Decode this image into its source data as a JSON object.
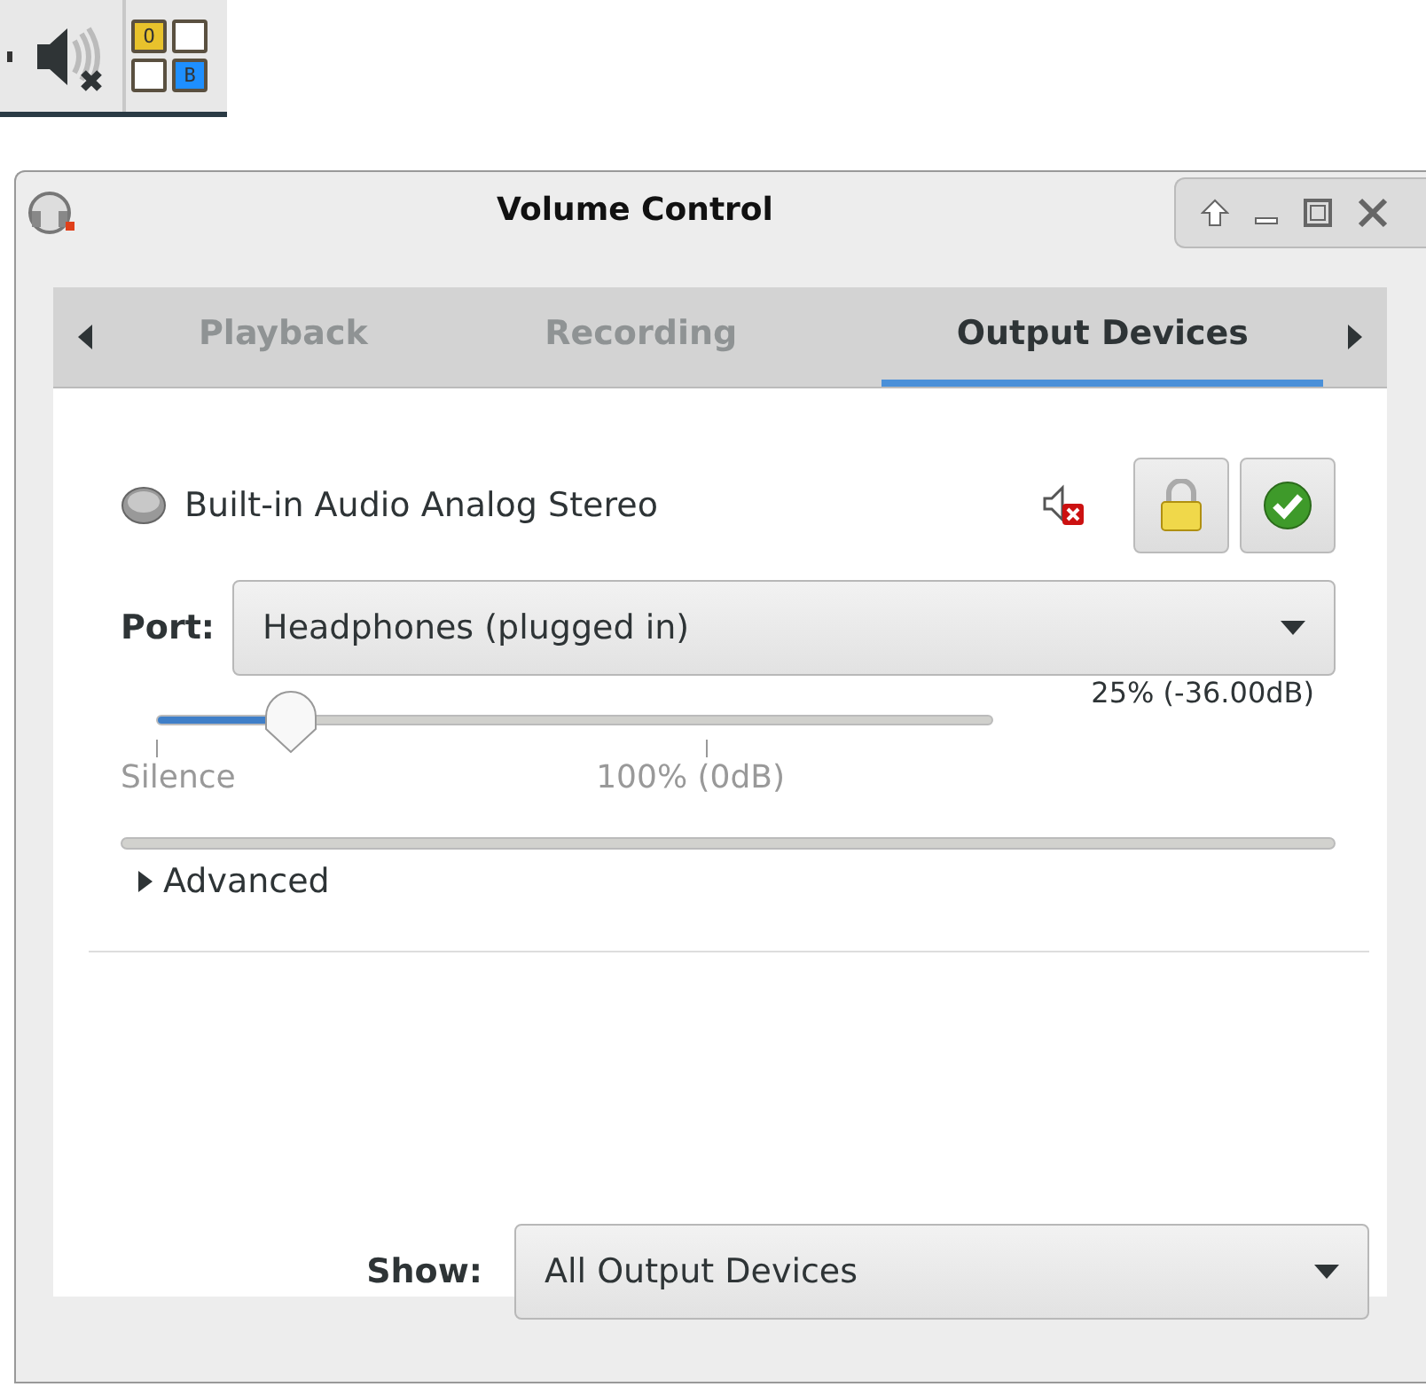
{
  "tray": {
    "pager": [
      {
        "label": "O",
        "color": "#e8c22c"
      },
      {
        "color": "#ffffff"
      },
      {
        "color": "#ffffff"
      },
      {
        "label": "B",
        "color": "#1e8fff"
      }
    ]
  },
  "window": {
    "title": "Volume Control"
  },
  "tabs": [
    {
      "label": "Playback",
      "selected": false
    },
    {
      "label": "Recording",
      "selected": false
    },
    {
      "label": "Output Devices",
      "selected": true
    }
  ],
  "device": {
    "name": "Built-in Audio Analog Stereo",
    "port_label": "Port:",
    "port": "Headphones (plugged in)",
    "volume": {
      "level": 0.16,
      "reading": "25% (-36.00dB)",
      "marks": [
        "Silence",
        "100% (0dB)"
      ]
    },
    "meter": {
      "level": 0
    },
    "advanced": {
      "label": "Advanced",
      "expanded": false
    }
  },
  "show": {
    "label": "Show:",
    "value": "All Output Devices"
  }
}
